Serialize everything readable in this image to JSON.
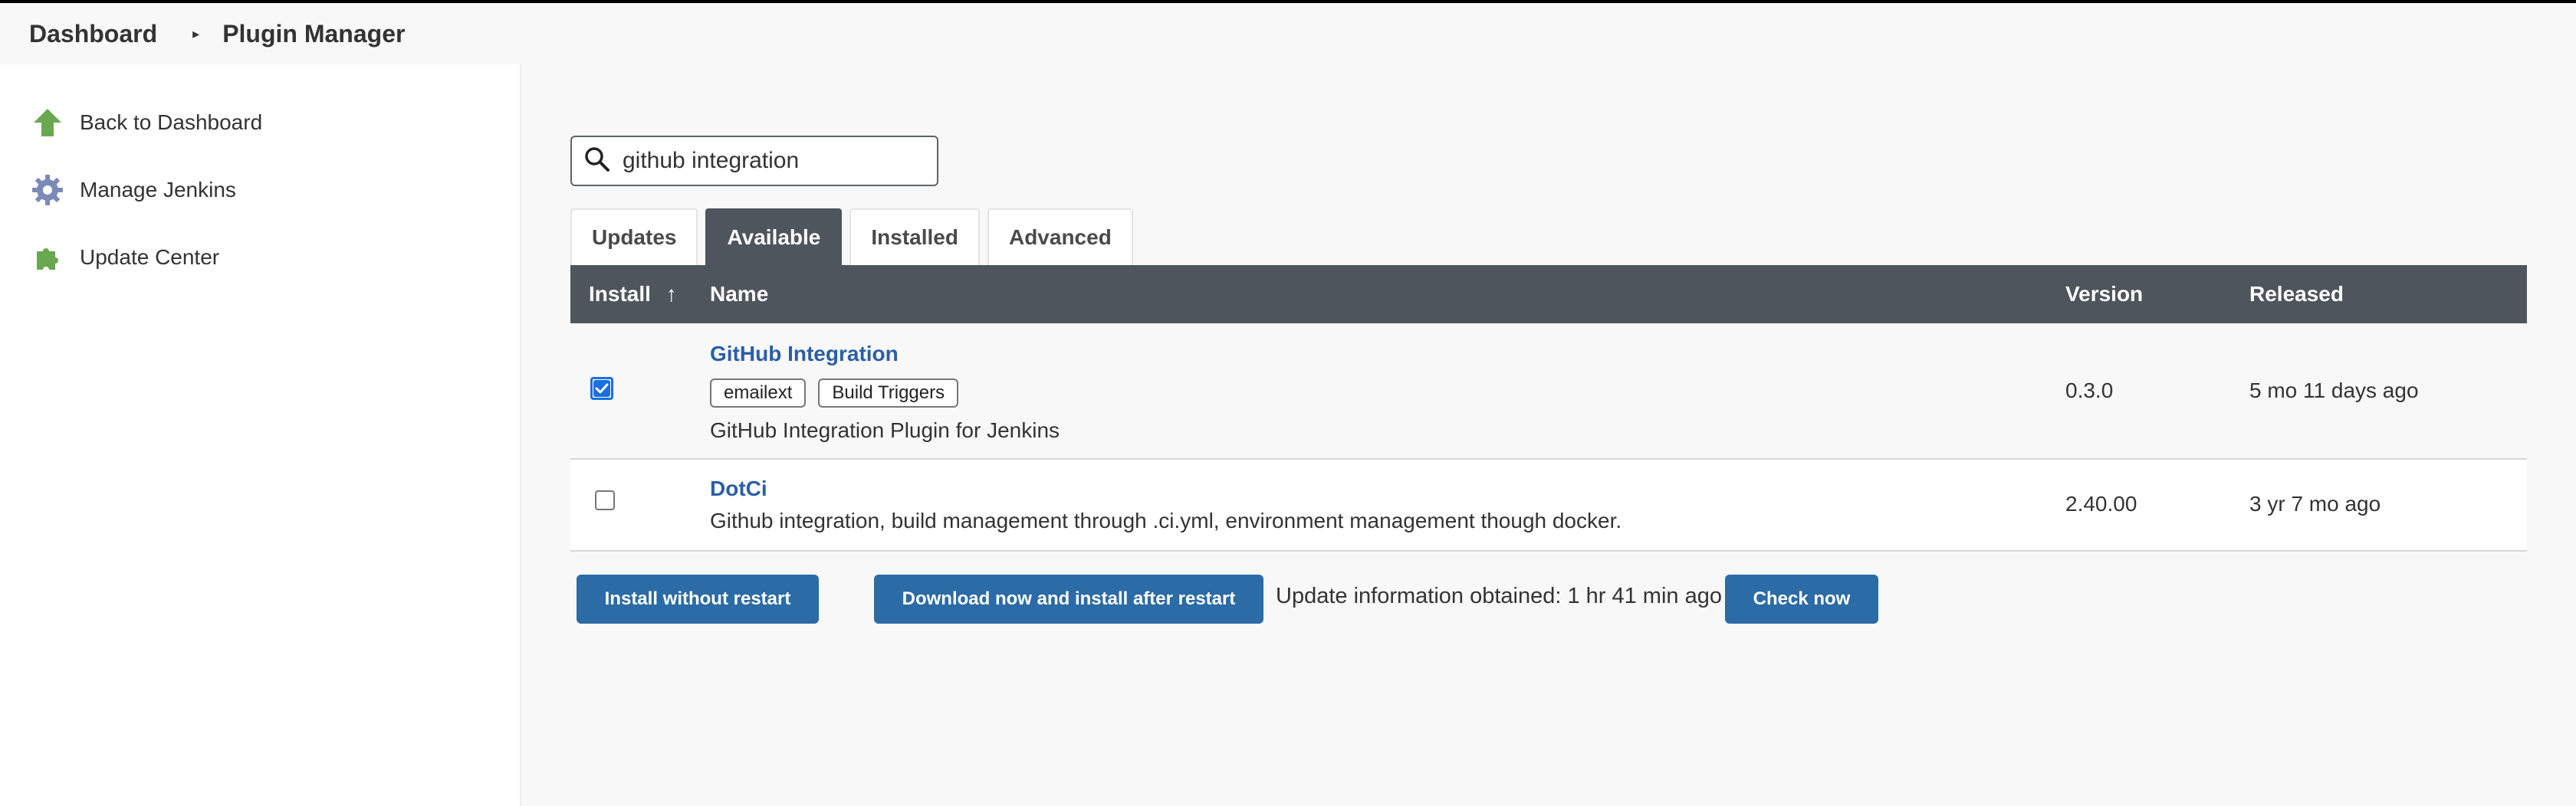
{
  "breadcrumb": {
    "items": [
      "Dashboard",
      "Plugin Manager"
    ]
  },
  "sidebar": {
    "items": [
      {
        "label": "Back to Dashboard",
        "icon": "up-arrow-icon"
      },
      {
        "label": "Manage Jenkins",
        "icon": "gear-icon"
      },
      {
        "label": "Update Center",
        "icon": "puzzle-icon"
      }
    ]
  },
  "search": {
    "value": "github integration"
  },
  "tabs": [
    {
      "label": "Updates",
      "active": false
    },
    {
      "label": "Available",
      "active": true
    },
    {
      "label": "Installed",
      "active": false
    },
    {
      "label": "Advanced",
      "active": false
    }
  ],
  "table": {
    "headers": {
      "install": "Install",
      "sort_indicator": "↑",
      "name": "Name",
      "version": "Version",
      "released": "Released"
    },
    "rows": [
      {
        "name": "GitHub Integration",
        "tags": [
          "emailext",
          "Build Triggers"
        ],
        "description": "GitHub Integration Plugin for Jenkins",
        "version": "0.3.0",
        "released": "5 mo 11 days ago",
        "checked": true
      },
      {
        "name": "DotCi",
        "tags": [],
        "description": "Github integration, build management through .ci.yml, environment management though docker.",
        "version": "2.40.00",
        "released": "3 yr 7 mo ago",
        "checked": false
      }
    ]
  },
  "actions": {
    "install_without_restart": "Install without restart",
    "download_install_after_restart": "Download now and install after restart",
    "update_info": "Update information obtained: 1 hr 41 min ago",
    "check_now": "Check now"
  },
  "colors": {
    "header_bg": "#4e555c",
    "button_bg": "#2b6ba6",
    "link": "#2b5ea7",
    "checkbox_accent": "#1a6fe0"
  }
}
